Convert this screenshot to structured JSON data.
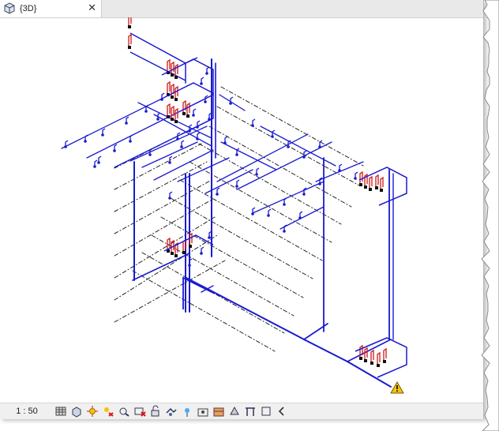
{
  "view_tab": {
    "title": "{3D}",
    "close_glyph": "✕",
    "icon": "3d-view-cube-icon"
  },
  "status_bar": {
    "scale": "1 : 50",
    "icons": [
      "detail-level-icon",
      "visual-style-icon",
      "sun-path-icon",
      "shadows-icon",
      "crop-view-icon",
      "show-crop-region-icon",
      "unlock-3d-view-icon",
      "temporary-hide-isolate-icon",
      "reveal-hidden-elements-icon",
      "worksharing-display-icon",
      "analytical-model-icon",
      "highlight-displacement-icon",
      "reveal-constraints-icon",
      "show-hide-view-icon",
      "collapse-arrow-icon"
    ]
  },
  "canvas": {
    "content": "isometric-piping-model",
    "pipe_color": "#1a1ad0",
    "fixture_color": "#cc1a1a",
    "warning_icon": "warning-triangle-icon"
  }
}
